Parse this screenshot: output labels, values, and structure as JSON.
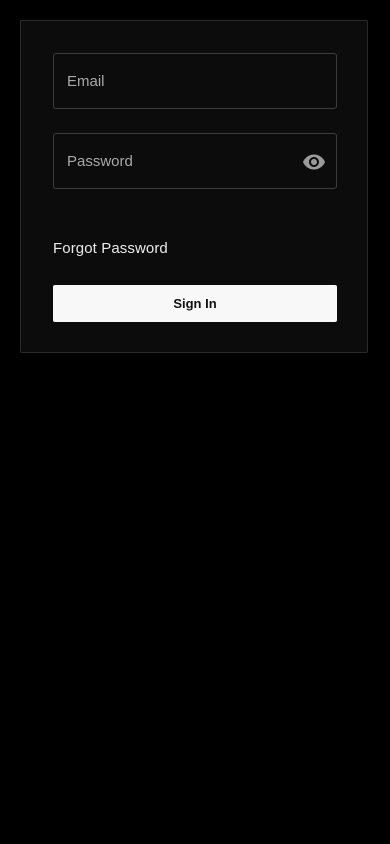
{
  "login": {
    "email": {
      "placeholder": "Email",
      "value": ""
    },
    "password": {
      "placeholder": "Password",
      "value": "",
      "toggle_icon": "eye-icon"
    },
    "forgot_label": "Forgot Password",
    "submit_label": "Sign In"
  },
  "colors": {
    "background": "#000000",
    "card": "#0c0c0c",
    "button_bg": "#f8f8f8",
    "button_text": "#111111"
  }
}
